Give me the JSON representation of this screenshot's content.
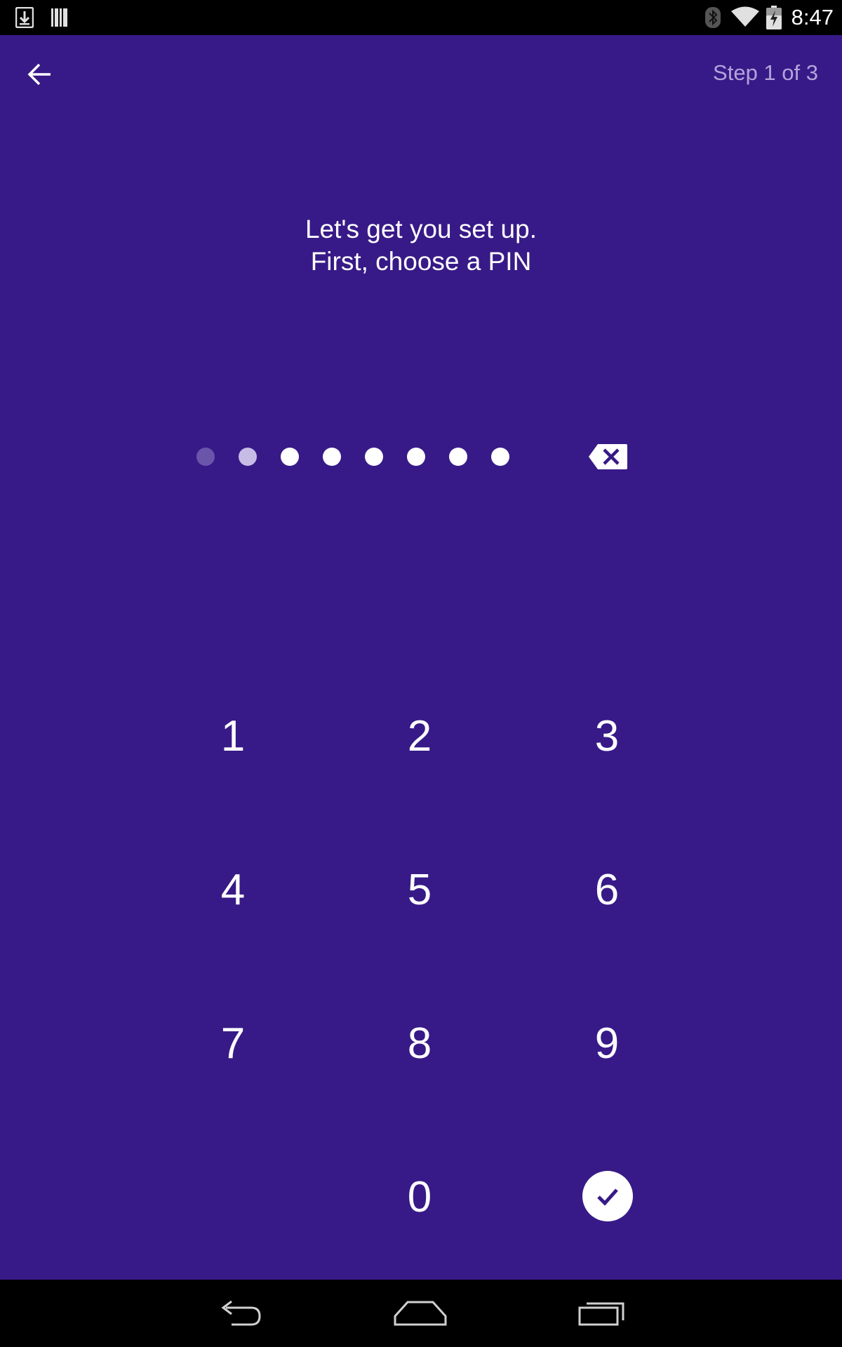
{
  "status_bar": {
    "time": "8:47",
    "left_icons": [
      "download-icon",
      "barcode-icon"
    ],
    "right_icons": [
      "bluetooth-icon",
      "wifi-icon",
      "battery-charging-icon"
    ]
  },
  "header": {
    "back_icon": "arrow-left-icon",
    "step_text": "Step 1 of 3"
  },
  "prompt": {
    "line1": "Let's get you set up.",
    "line2": "First, choose a PIN"
  },
  "pin": {
    "dot_count": 8,
    "dot_states": [
      "dim",
      "mid",
      "full",
      "full",
      "full",
      "full",
      "full",
      "full"
    ],
    "delete_icon": "backspace-icon"
  },
  "keypad": {
    "keys": [
      "1",
      "2",
      "3",
      "4",
      "5",
      "6",
      "7",
      "8",
      "9",
      "0"
    ],
    "confirm_icon": "check-icon"
  },
  "nav_bar": {
    "buttons": [
      "back-nav-icon",
      "home-nav-icon",
      "recents-nav-icon"
    ]
  },
  "colors": {
    "background": "#371A87",
    "step_text": "#B3A4DB",
    "dot_dim": "#6A55AA",
    "dot_mid": "#C7BCE6",
    "dot_full": "#FFFFFF",
    "confirm_check": "#371A87"
  }
}
